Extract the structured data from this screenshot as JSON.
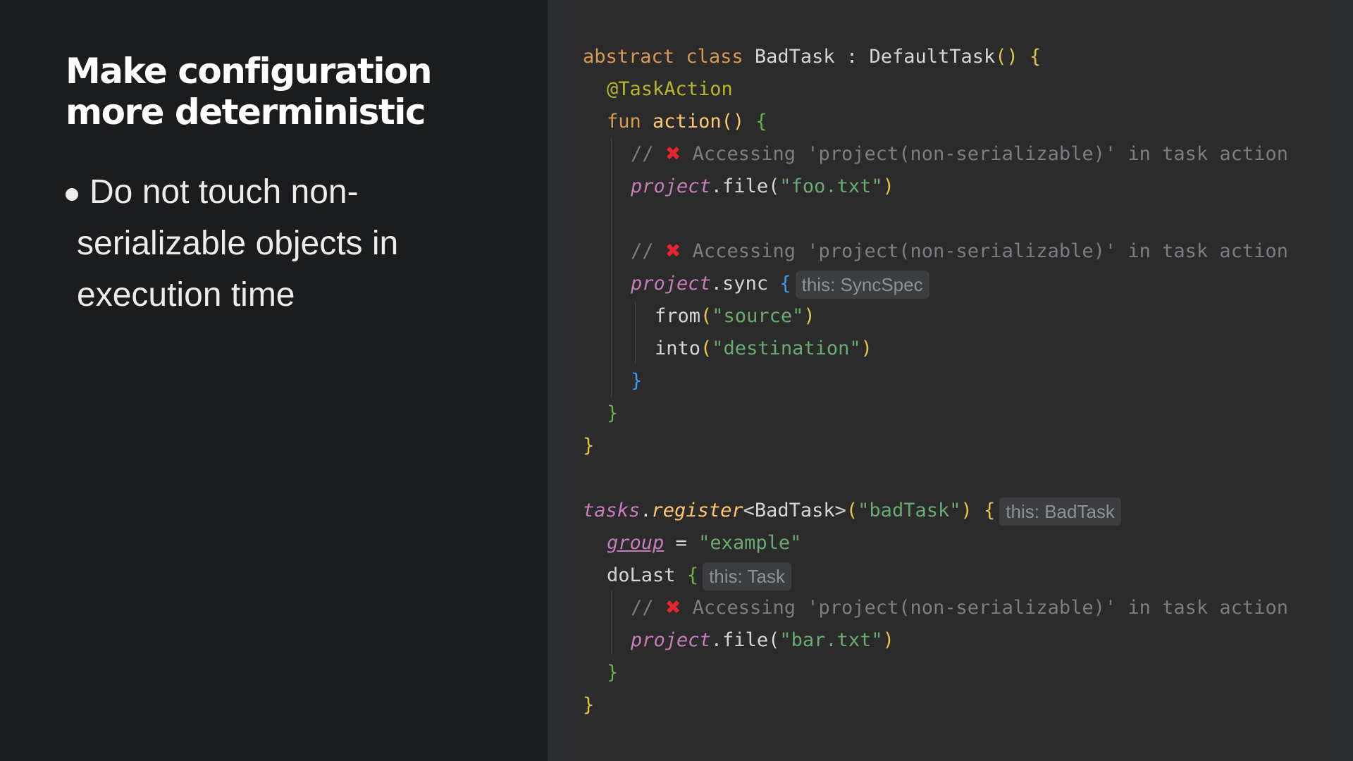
{
  "slide": {
    "title_line1": "Make configuration",
    "title_line2": "more deterministic",
    "bullet_line1": "Do not touch non-",
    "bullet_line2": "serializable objects in",
    "bullet_line3": "execution time"
  },
  "code": {
    "l1_abstract": "abstract",
    "l1_class": "class",
    "l1_name": "BadTask",
    "l1_colon": " : ",
    "l1_parent": "DefaultTask",
    "l1_paren": "()",
    "brace_open": "{",
    "brace_close": "}",
    "annotation": "@TaskAction",
    "fun_kw": "fun",
    "fun_name": "action",
    "comment_slashes": "//",
    "error_icon": "✖",
    "comment_text": "Accessing 'project(non-serializable)' in task action",
    "project": "project",
    "dot_file": ".file(",
    "dot_sync": ".sync",
    "close_paren": ")",
    "foo_str": "\"foo.txt\"",
    "bar_str": "\"bar.txt\"",
    "hint_syncspec": "this: SyncSpec",
    "from_fn": "from",
    "source_str": "\"source\"",
    "into_fn": "into",
    "dest_str": "\"destination\"",
    "tasks": "tasks",
    "register": "register",
    "generic": "<BadTask>",
    "badtask_str": "\"badTask\"",
    "hint_badtask": "this: BadTask",
    "group": "group",
    "equals": " = ",
    "example_str": "\"example\"",
    "dolast": "doLast",
    "hint_task": "this: Task"
  },
  "colors": {
    "keyword": "#d79a52",
    "function": "#ffc66d",
    "string": "#6aab73",
    "comment": "#7a7e85",
    "error": "#e5252f",
    "property": "#c77dbb"
  }
}
